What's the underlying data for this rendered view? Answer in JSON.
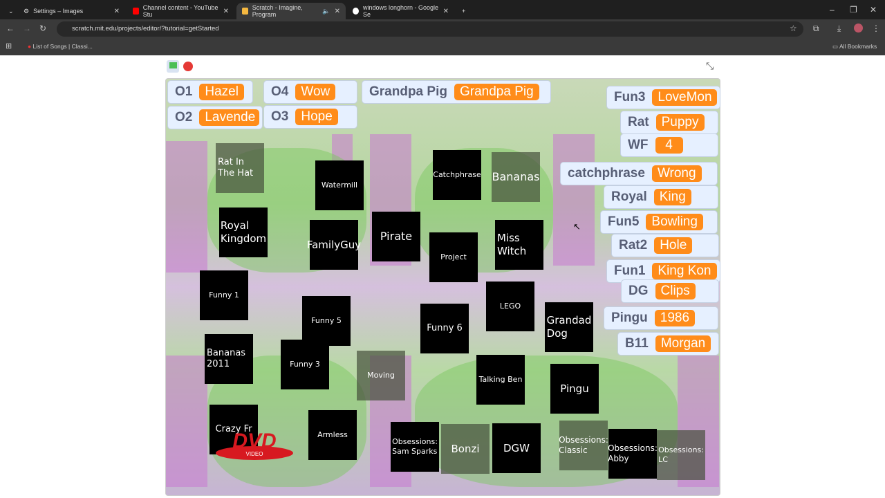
{
  "browser": {
    "tabs": [
      {
        "title": "Settings – Images",
        "icon": "gear-icon"
      },
      {
        "title": "Channel content - YouTube Stu",
        "icon": "youtube-icon"
      },
      {
        "title": "Scratch - Imagine, Program",
        "icon": "scratch-icon",
        "active": true
      },
      {
        "title": "windows longhorn - Google Se",
        "icon": "google-icon"
      }
    ],
    "url": "scratch.mit.edu/projects/editor/?tutorial=getStarted",
    "bookmark": "List of Songs | Classi...",
    "all_bookmarks": "All Bookmarks"
  },
  "monitors": [
    {
      "label": "O1",
      "value": "Hazel"
    },
    {
      "label": "O4",
      "value": "Wow"
    },
    {
      "label": "Grandpa Pig",
      "value": "Grandpa Pig"
    },
    {
      "label": "O2",
      "value": "Lavende"
    },
    {
      "label": "O3",
      "value": "Hope"
    },
    {
      "label": "Fun3",
      "value": "LoveMon"
    },
    {
      "label": "Rat",
      "value": "Puppy"
    },
    {
      "label": "WF",
      "value": "4"
    },
    {
      "label": "catchphrase",
      "value": "Wrong"
    },
    {
      "label": "Royal",
      "value": "King"
    },
    {
      "label": "Fun5",
      "value": "Bowling"
    },
    {
      "label": "Rat2",
      "value": "Hole"
    },
    {
      "label": "Fun1",
      "value": "King Kon"
    },
    {
      "label": "DG",
      "value": "Clips"
    },
    {
      "label": "Pingu",
      "value": "1986"
    },
    {
      "label": "B11",
      "value": "Morgan"
    }
  ],
  "sprites": [
    "Rat In The Hat",
    "Watermill",
    "Catchphrase",
    "Bananas",
    "Royal Kingdom",
    "FamilyGuy",
    "Pirate",
    "Project",
    "Miss Witch",
    "Funny 1",
    "Funny 5",
    "Funny 6",
    "LEGO",
    "Grandad Dog",
    "Bananas 2011",
    "Funny 3",
    "Moving",
    "Talking Ben",
    "Pingu",
    "Crazy Fr",
    "Armless",
    "Obsessions: Sam Sparks",
    "Bonzi",
    "DGW",
    "Obsessions: Classic",
    "Obsessions: Abby",
    "Obsessions: LC"
  ],
  "dvd_logo": "DVD VIDEO",
  "colors": {
    "monitor_value": "#ff8c1a",
    "monitor_label": "#575e75",
    "stop": "#e53935",
    "flag": "#4cbf56"
  }
}
